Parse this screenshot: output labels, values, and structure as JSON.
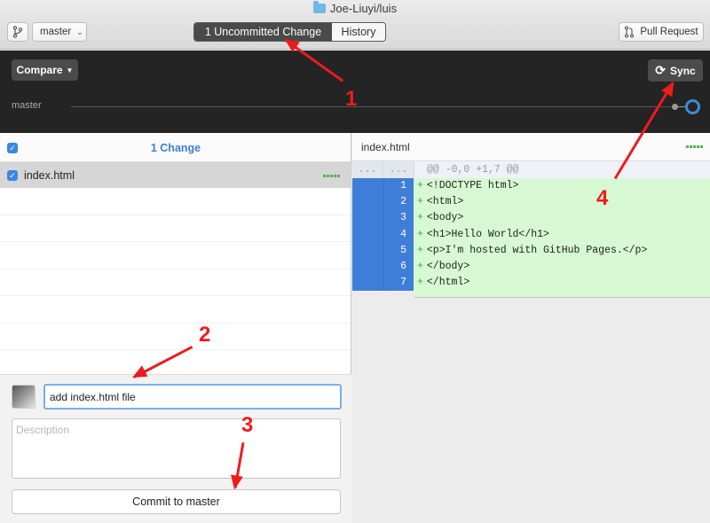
{
  "window": {
    "title": "Joe-Liuyi/luis"
  },
  "toolbar": {
    "branch": "master",
    "segments": [
      "1 Uncommitted Change",
      "History"
    ],
    "pull_request": "Pull Request"
  },
  "syncbar": {
    "compare": "Compare",
    "sync": "Sync",
    "branch_label": "master"
  },
  "changes": {
    "title": "1 Change",
    "files": [
      {
        "name": "index.html",
        "checked": true
      }
    ]
  },
  "commit": {
    "summary": "add index.html file",
    "description_placeholder": "Description",
    "button": "Commit to master"
  },
  "diff": {
    "file": "index.html",
    "hunk_header": "@@ -0,0 +1,7 @@",
    "hunk_ln": "...",
    "lines": [
      {
        "n": "1",
        "code": "<!DOCTYPE html>"
      },
      {
        "n": "2",
        "code": "<html>"
      },
      {
        "n": "3",
        "code": "<body>"
      },
      {
        "n": "4",
        "code": "<h1>Hello World</h1>"
      },
      {
        "n": "5",
        "code": "<p>I'm hosted with GitHub Pages.</p>"
      },
      {
        "n": "6",
        "code": "</body>"
      },
      {
        "n": "7",
        "code": "</html>"
      }
    ]
  },
  "annotations": {
    "a1": "1",
    "a2": "2",
    "a3": "3",
    "a4": "4"
  },
  "colors": {
    "accent": "#3a87e0",
    "annotation": "#ee1b1b",
    "added_bg": "#d6f8d2",
    "gutter": "#3f7ed8"
  }
}
